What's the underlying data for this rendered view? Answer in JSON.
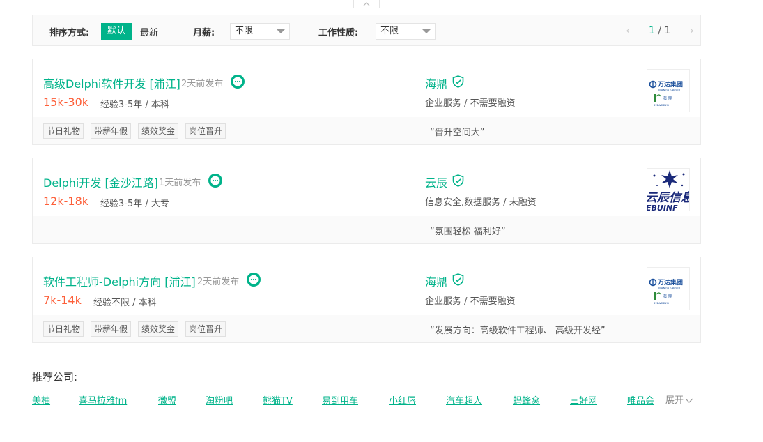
{
  "filter": {
    "sort_label": "排序方式:",
    "sort_default": "默认",
    "sort_latest": "最新",
    "salary_label": "月薪:",
    "salary_value": "不限",
    "nature_label": "工作性质:",
    "nature_value": "不限",
    "pager_current": "1",
    "pager_sep": "/",
    "pager_total": "1"
  },
  "jobs": [
    {
      "title": "高级Delphi软件开发 [浦江]",
      "posted": "2天前发布",
      "salary": "15k-30k",
      "requirement": "经验3-5年 / 本科",
      "company": "海鼎",
      "industry": "企业服务 / 不需要融资",
      "tags": [
        "节日礼物",
        "带薪年假",
        "绩效奖金",
        "岗位晋升"
      ],
      "slogan": "“晋升空间大”",
      "logo": {
        "line1": "万达集团",
        "line2": "WANDA GROUP",
        "line3": "海 鼎",
        "line4": "HEADING"
      }
    },
    {
      "title": "Delphi开发 [金沙江路]",
      "posted": "1天前发布",
      "salary": "12k-18k",
      "requirement": "经验3-5年 / 大专",
      "company": "云辰",
      "industry": "信息安全,数据服务 / 未融资",
      "tags": [],
      "slogan": "“氛围轻松 福利好”",
      "logo": {
        "line1": "云辰信息",
        "line2": "EBUINF"
      }
    },
    {
      "title": "软件工程师-Delphi方向 [浦江]",
      "posted": "2天前发布",
      "salary": "7k-14k",
      "requirement": "经验不限 / 本科",
      "company": "海鼎",
      "industry": "企业服务 / 不需要融资",
      "tags": [
        "节日礼物",
        "带薪年假",
        "绩效奖金",
        "岗位晋升"
      ],
      "slogan": "“发展方向：高级软件工程师、 高级开发经”",
      "logo": {
        "line1": "万达集团",
        "line2": "WANDA GROUP",
        "line3": "海 鼎",
        "line4": "HEADING"
      }
    }
  ],
  "recommend": {
    "title": "推荐公司:",
    "companies": [
      "美柚",
      "喜马拉雅fm",
      "微盟",
      "淘粉吧",
      "熊猫TV",
      "易到用车",
      "小红唇",
      "汽车超人",
      "蚂蜂窝",
      "三好网",
      "唯品会"
    ],
    "expand": "展开"
  },
  "colors": {
    "accent": "#00b38a",
    "salary": "#fd5f39"
  },
  "icons": {
    "chat": "chat-bubble-icon",
    "verify": "shield-check-icon",
    "collapse": "chevron-up-icon",
    "prev": "chevron-left-icon",
    "next": "chevron-right-icon",
    "expand": "chevron-down-icon"
  }
}
